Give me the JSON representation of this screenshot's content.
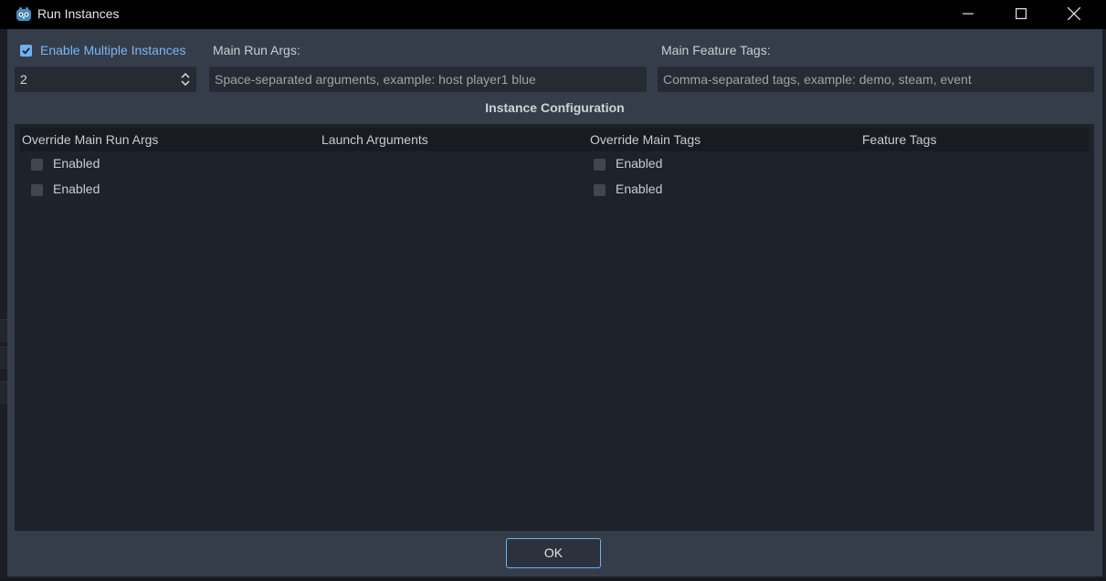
{
  "window": {
    "title": "Run Instances",
    "controls": [
      "minimize-icon",
      "maximize-icon",
      "close-icon"
    ]
  },
  "top": {
    "enable_multiple": {
      "label": "Enable Multiple Instances",
      "checked": true
    },
    "instance_count": {
      "value": "2"
    },
    "main_run_args": {
      "label": "Main Run Args:",
      "placeholder": "Space-separated arguments, example: host player1 blue"
    },
    "main_feature_tags": {
      "label": "Main Feature Tags:",
      "placeholder": "Comma-separated tags, example: demo, steam, event"
    }
  },
  "instance_configuration": {
    "title": "Instance Configuration",
    "columns": [
      "Override Main Run Args",
      "Launch Arguments",
      "Override Main Tags",
      "Feature Tags"
    ],
    "rows": [
      {
        "override_args": "Enabled",
        "override_tags": "Enabled"
      },
      {
        "override_args": "Enabled",
        "override_tags": "Enabled"
      }
    ]
  },
  "footer": {
    "ok_label": "OK"
  },
  "colors": {
    "accent": "#6fb1f2",
    "dialog_bg": "#363d4a",
    "panel_bg": "#1e222a"
  }
}
